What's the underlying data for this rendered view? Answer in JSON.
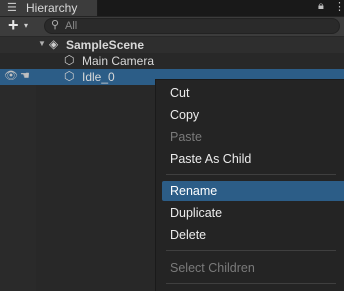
{
  "window": {
    "tab_label": "Hierarchy",
    "tab_icon": "list-icon",
    "lock_icon": "lock-icon",
    "menu_icon": "kebab-icon"
  },
  "toolbar": {
    "add_label": "+",
    "add_dropdown": "▾",
    "search_placeholder": "All"
  },
  "tree": {
    "scene": {
      "label": "SampleScene",
      "icon": "unity-logo-icon"
    },
    "items": [
      {
        "label": "Main Camera",
        "icon": "gameobject-cube-icon"
      },
      {
        "label": "Idle_0",
        "icon": "gameobject-cube-icon",
        "selected": true
      }
    ]
  },
  "context_menu": {
    "items": [
      {
        "label": "Cut",
        "enabled": true
      },
      {
        "label": "Copy",
        "enabled": true
      },
      {
        "label": "Paste",
        "enabled": false
      },
      {
        "label": "Paste As Child",
        "enabled": true
      },
      {
        "label": "Rename",
        "enabled": true,
        "highlighted": true
      },
      {
        "label": "Duplicate",
        "enabled": true
      },
      {
        "label": "Delete",
        "enabled": true
      },
      {
        "label": "Select Children",
        "enabled": false
      }
    ]
  },
  "colors": {
    "selection": "#2c5d87",
    "background": "#282828",
    "menu_background": "#242424"
  }
}
